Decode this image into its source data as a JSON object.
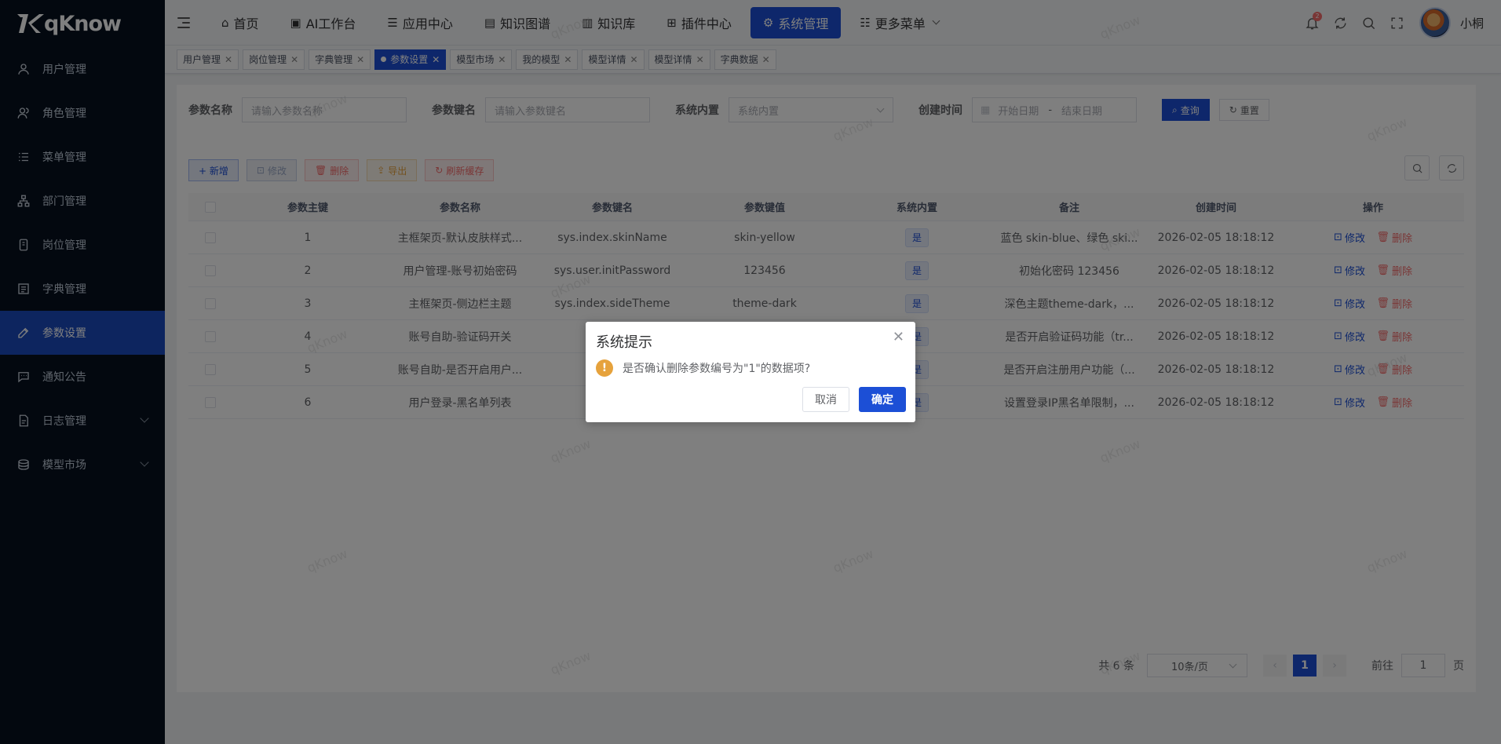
{
  "brand": {
    "name": "qKnow"
  },
  "sidebar": {
    "items": [
      {
        "label": "用户管理",
        "icon": "user-icon"
      },
      {
        "label": "角色管理",
        "icon": "users-icon"
      },
      {
        "label": "菜单管理",
        "icon": "list-icon"
      },
      {
        "label": "部门管理",
        "icon": "org-tree-icon"
      },
      {
        "label": "岗位管理",
        "icon": "post-icon"
      },
      {
        "label": "字典管理",
        "icon": "dictionary-icon"
      },
      {
        "label": "参数设置",
        "icon": "edit-icon",
        "active": true
      },
      {
        "label": "通知公告",
        "icon": "message-icon"
      },
      {
        "label": "日志管理",
        "icon": "log-icon",
        "expandable": true
      },
      {
        "label": "模型市场",
        "icon": "model-icon",
        "expandable": true
      }
    ]
  },
  "navbar": {
    "items": [
      {
        "label": "首页",
        "icon": "⌂"
      },
      {
        "label": "AI工作台",
        "icon": "▣"
      },
      {
        "label": "应用中心",
        "icon": "☰"
      },
      {
        "label": "知识图谱",
        "icon": "▤"
      },
      {
        "label": "知识库",
        "icon": "▥"
      },
      {
        "label": "插件中心",
        "icon": "⊞"
      },
      {
        "label": "系统管理",
        "icon": "⚙",
        "active": true
      },
      {
        "label": "更多菜单",
        "icon": "☷"
      }
    ],
    "notification_count": "2",
    "username": "小桐"
  },
  "tags": [
    {
      "label": "用户管理"
    },
    {
      "label": "岗位管理"
    },
    {
      "label": "字典管理"
    },
    {
      "label": "参数设置",
      "active": true
    },
    {
      "label": "模型市场"
    },
    {
      "label": "我的模型"
    },
    {
      "label": "模型详情"
    },
    {
      "label": "模型详情"
    },
    {
      "label": "字典数据"
    }
  ],
  "search": {
    "param_name_label": "参数名称",
    "param_name_placeholder": "请输入参数名称",
    "param_key_label": "参数键名",
    "param_key_placeholder": "请输入参数键名",
    "builtin_label": "系统内置",
    "builtin_placeholder": "系统内置",
    "created_label": "创建时间",
    "start_placeholder": "开始日期",
    "range_sep": "-",
    "end_placeholder": "结束日期",
    "query_label": "查询",
    "reset_label": "重置"
  },
  "toolbar": {
    "add_label": "+ 新增",
    "edit_label": "修改",
    "delete_label": "删除",
    "export_label": "导出",
    "refresh_cache_label": "刷新缓存"
  },
  "table": {
    "columns": [
      "参数主键",
      "参数名称",
      "参数键名",
      "参数键值",
      "系统内置",
      "备注",
      "创建时间",
      "操作"
    ],
    "rows": [
      {
        "id": "1",
        "name": "主框架页-默认皮肤样式...",
        "key": "sys.index.skinName",
        "value": "skin-yellow",
        "builtin": "是",
        "remark": "蓝色 skin-blue、绿色 ski...",
        "created": "2026-02-05 18:18:12"
      },
      {
        "id": "2",
        "name": "用户管理-账号初始密码",
        "key": "sys.user.initPassword",
        "value": "123456",
        "builtin": "是",
        "remark": "初始化密码 123456",
        "created": "2026-02-05 18:18:12"
      },
      {
        "id": "3",
        "name": "主框架页-侧边栏主题",
        "key": "sys.index.sideTheme",
        "value": "theme-dark",
        "builtin": "是",
        "remark": "深色主题theme-dark，...",
        "created": "2026-02-05 18:18:12"
      },
      {
        "id": "4",
        "name": "账号自助-验证码开关",
        "key": "sys.acc",
        "value": "",
        "builtin": "是",
        "remark": "是否开启验证码功能（tr...",
        "created": "2026-02-05 18:18:12"
      },
      {
        "id": "5",
        "name": "账号自助-是否开启用户...",
        "key": "sys.ac",
        "value": "",
        "builtin": "是",
        "remark": "是否开启注册用户功能（...",
        "created": "2026-02-05 18:18:12"
      },
      {
        "id": "6",
        "name": "用户登录-黑名单列表",
        "key": "sys.l",
        "value": "",
        "builtin": "是",
        "remark": "设置登录IP黑名单限制，...",
        "created": "2026-02-05 18:18:12"
      }
    ],
    "edit_action": "修改",
    "delete_action": "删除"
  },
  "pagination": {
    "total": "共 6 条",
    "page_size": "10条/页",
    "prev": "‹",
    "current": "1",
    "next": "›",
    "goto_label": "前往",
    "goto_value": "1",
    "page_suffix": "页"
  },
  "dialog": {
    "title": "系统提示",
    "message": "是否确认删除参数编号为\"1\"的数据项?",
    "cancel_label": "取消",
    "confirm_label": "确定",
    "warning_glyph": "!"
  },
  "watermark": "qKnow",
  "colors": {
    "primary": "#1c4fd6",
    "sidebar_bg": "#06111f",
    "danger": "#f56c6c",
    "warning": "#e6a23c"
  }
}
